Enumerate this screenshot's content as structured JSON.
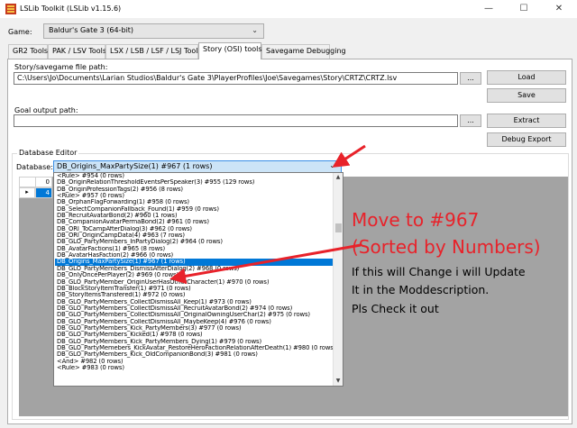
{
  "window": {
    "title": "LSLib Toolkit (LSLib v1.15.6)",
    "minimize": "—",
    "maximize": "☐",
    "close": "✕"
  },
  "game": {
    "label": "Game:",
    "selected": "Baldur's Gate 3 (64-bit)"
  },
  "tabs": [
    {
      "label": "GR2 Tools"
    },
    {
      "label": "PAK / LSV Tools"
    },
    {
      "label": "LSX / LSB / LSF / LSJ Tools"
    },
    {
      "label": "Story (OSI) tools"
    },
    {
      "label": "Savegame Debugging"
    }
  ],
  "story": {
    "path_label": "Story/savegame file path:",
    "path_value": "C:\\Users\\Jo\\Documents\\Larian Studios\\Baldur's Gate 3\\PlayerProfiles\\Joe\\Savegames\\Story\\CRTZ\\CRTZ.lsv",
    "browse": "...",
    "load": "Load",
    "save": "Save",
    "goal_label": "Goal output path:",
    "goal_value": "",
    "goal_browse": "...",
    "extract": "Extract",
    "debug_export": "Debug Export"
  },
  "database_editor": {
    "group_title": "Database Editor",
    "db_label": "Database:",
    "selected": "DB_Origins_MaxPartySize(1) #967 (1 rows)",
    "grid_rows": [
      {
        "header": "",
        "value": "0"
      },
      {
        "header": "▸",
        "value": "4"
      }
    ],
    "items": [
      "<Rule> #954 (0 rows)",
      "DB_OriginRelationThresholdEventsPerSpeaker(3) #955 (129 rows)",
      "DB_OriginProfessionTags(2) #956 (8 rows)",
      "<Rule> #957 (0 rows)",
      "DB_OrphanFlagForwarding(1) #958 (0 rows)",
      "DB_SelectCompanionFallback_Found(1) #959 (0 rows)",
      "DB_RecruitAvatarBond(2) #960 (1 rows)",
      "DB_CompanionAvatarPermaBond(2) #961 (0 rows)",
      "DB_ORI_ToCampAfterDialog(3) #962 (0 rows)",
      "DB_ORI_OriginCampData(4) #963 (7 rows)",
      "DB_GLO_PartyMembers_InPartyDialog(2) #964 (0 rows)",
      "DB_AvatarFactions(1) #965 (8 rows)",
      "DB_AvatarHasFaction(2) #966 (0 rows)",
      "DB_Origins_MaxPartySize(1) #967 (1 rows)",
      "DB_GLO_PartyMembers_DismissAfterDialog(2) #968 (0 rows)",
      "DB_OnlyOncePerPlayer(2) #969 (0 rows)",
      "DB_GLO_PartyMember_OriginUserHasOtherCharacter(1) #970 (0 rows)",
      "DB_BlockStoryItemTransfer(1) #971 (0 rows)",
      "DB_StoryItemsTransfered(1) #972 (0 rows)",
      "DB_GLO_PartyMembers_CollectDismissAll_Keep(1) #973 (0 rows)",
      "DB_GLO_PartyMembers_CollectDismissAll_RecruitAvatarBond(2) #974 (0 rows)",
      "DB_GLO_PartyMembers_CollectDismissAll_OriginalOwningUserChar(2) #975 (0 rows)",
      "DB_GLO_PartyMembers_CollectDismissAll_MaybeKeep(4) #976 (0 rows)",
      "DB_GLO_PartyMembers_Kick_PartyMembers(3) #977 (0 rows)",
      "DB_GLO_PartyMembers_Kicked(1) #978 (0 rows)",
      "DB_GLO_PartyMembers_Kick_PartyMembers_Dying(1) #979 (0 rows)",
      "DB_GLO_PartyMemebers_KickAvatar_RestoreHeroFactionRelationAfterDeath(1) #980 (0 rows)",
      "DB_GLO_PartyMembers_Kick_OldCompanionBond(3) #981 (0 rows)",
      "<And> #982 (0 rows)",
      "<Rule> #983 (0 rows)"
    ],
    "selected_index": 13
  },
  "annotation": {
    "line1": "Move to #967",
    "line2": "(Sorted by Numbers)",
    "line3": "If this will Change i will Update",
    "line4": "It in the Moddescription.",
    "line5": "Pls Check it out"
  },
  "colors": {
    "accent": "#0078d7",
    "annotation_red": "#e8222a"
  }
}
